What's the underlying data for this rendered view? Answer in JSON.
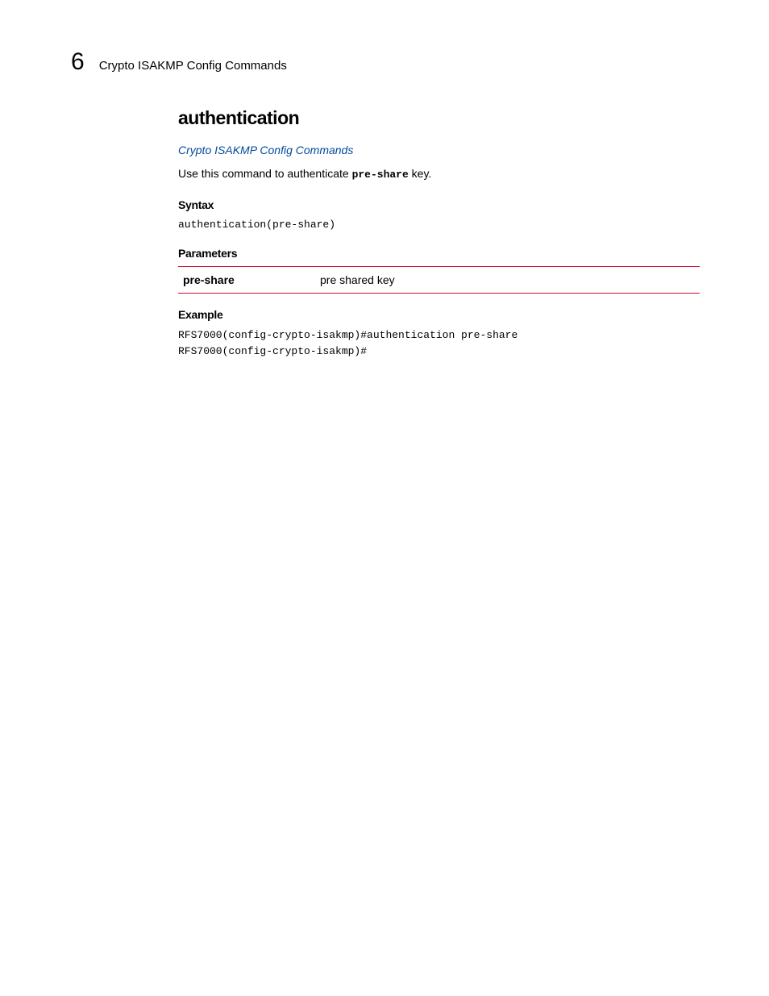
{
  "header": {
    "chapter_number": "6",
    "title": "Crypto ISAKMP Config Commands"
  },
  "main": {
    "heading": "authentication",
    "link_text": "Crypto ISAKMP Config Commands",
    "intro_prefix": "Use this command to authenticate ",
    "intro_mono": "pre-share",
    "intro_suffix": "  key.",
    "syntax": {
      "label": "Syntax",
      "code": "authentication(pre-share)"
    },
    "parameters": {
      "label": "Parameters",
      "rows": [
        {
          "name": "pre-share",
          "description": "pre shared key"
        }
      ]
    },
    "example": {
      "label": "Example",
      "code": "RFS7000(config-crypto-isakmp)#authentication pre-share\nRFS7000(config-crypto-isakmp)#"
    }
  }
}
